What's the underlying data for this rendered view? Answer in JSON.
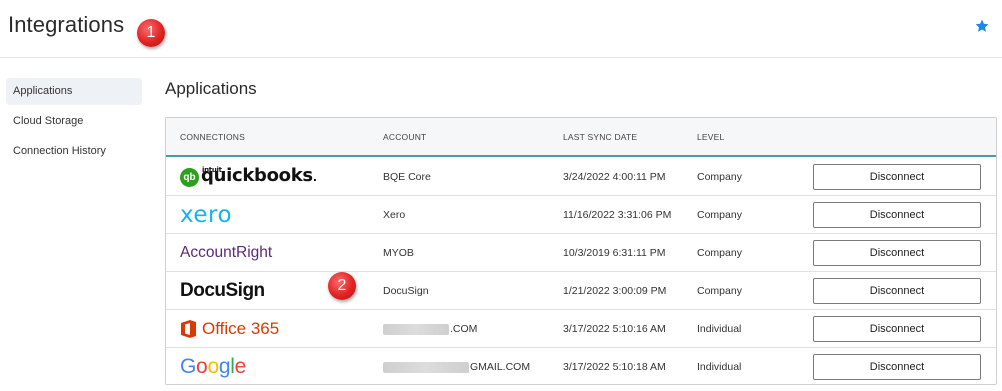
{
  "header": {
    "title": "Integrations",
    "favorite_icon": "star-icon",
    "accent": "#1e88e5"
  },
  "callouts": [
    "1",
    "2"
  ],
  "sidebar": {
    "items": [
      {
        "label": "Applications",
        "active": true
      },
      {
        "label": "Cloud Storage",
        "active": false
      },
      {
        "label": "Connection History",
        "active": false
      }
    ]
  },
  "main": {
    "title": "Applications",
    "columns": [
      "CONNECTIONS",
      "ACCOUNT",
      "LAST SYNC DATE",
      "LEVEL"
    ],
    "rows": [
      {
        "logo": {
          "intuit": "intuit",
          "name": "quickbooks",
          "dot": "."
        },
        "account": "BQE Core",
        "last_sync": "3/24/2022 4:00:11 PM",
        "level": "Company",
        "action": "Disconnect"
      },
      {
        "logo": {
          "name": "xero"
        },
        "account": "Xero",
        "last_sync": "11/16/2022 3:31:06 PM",
        "level": "Company",
        "action": "Disconnect"
      },
      {
        "logo": {
          "name": "AccountRight"
        },
        "account": "MYOB",
        "last_sync": "10/3/2019 6:31:11 PM",
        "level": "Company",
        "action": "Disconnect"
      },
      {
        "logo": {
          "name": "DocuSign"
        },
        "account": "DocuSign",
        "last_sync": "1/21/2022 3:00:09 PM",
        "level": "Company",
        "action": "Disconnect"
      },
      {
        "logo": {
          "name": "Office 365"
        },
        "account": ".COM",
        "last_sync": "3/17/2022 5:10:16 AM",
        "level": "Individual",
        "action": "Disconnect"
      },
      {
        "logo": {
          "name": "Google"
        },
        "account": "GMAIL.COM",
        "last_sync": "3/17/2022 5:10:18 AM",
        "level": "Individual",
        "action": "Disconnect"
      }
    ]
  },
  "colors": {
    "quickbooks_green": "#2ca01c",
    "xero_blue": "#13b5ea",
    "accountright_purple": "#5b2a7a",
    "office_orange": "#d83b01",
    "header_underline": "#4a9c9c"
  }
}
